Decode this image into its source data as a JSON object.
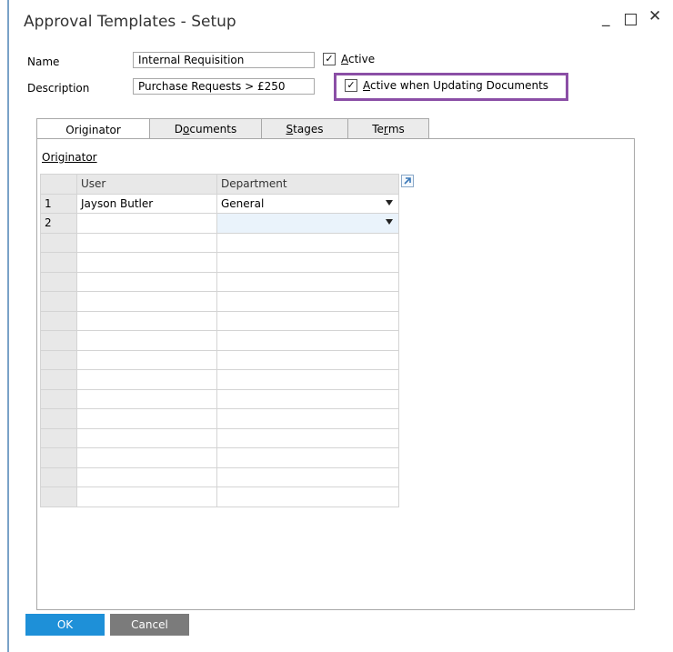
{
  "window": {
    "title": "Approval Templates - Setup",
    "min_label": "_",
    "close_label": "✕"
  },
  "header": {
    "name_label": "Name",
    "name_value": "Internal Requisition",
    "description_label": "Description",
    "description_value": "Purchase Requests > £250",
    "active_prefix": "A",
    "active_suffix": "ctive",
    "active_checked": "✓",
    "active_update_prefix": "A",
    "active_update_suffix": "ctive when Updating Documents",
    "active_update_checked": "✓"
  },
  "tabs": [
    {
      "pre": "Ori",
      "ul": "g",
      "post": "inator"
    },
    {
      "pre": "D",
      "ul": "o",
      "post": "cuments"
    },
    {
      "pre": "",
      "ul": "S",
      "post": "tages"
    },
    {
      "pre": "Te",
      "ul": "r",
      "post": "ms"
    }
  ],
  "section": {
    "title": "Originator"
  },
  "grid": {
    "col_user": "User",
    "col_department": "Department",
    "rows": [
      {
        "num": "1",
        "user": "Jayson Butler",
        "department": "General"
      },
      {
        "num": "2",
        "user": "",
        "department": ""
      }
    ]
  },
  "buttons": {
    "ok": "OK",
    "cancel": "Cancel"
  }
}
